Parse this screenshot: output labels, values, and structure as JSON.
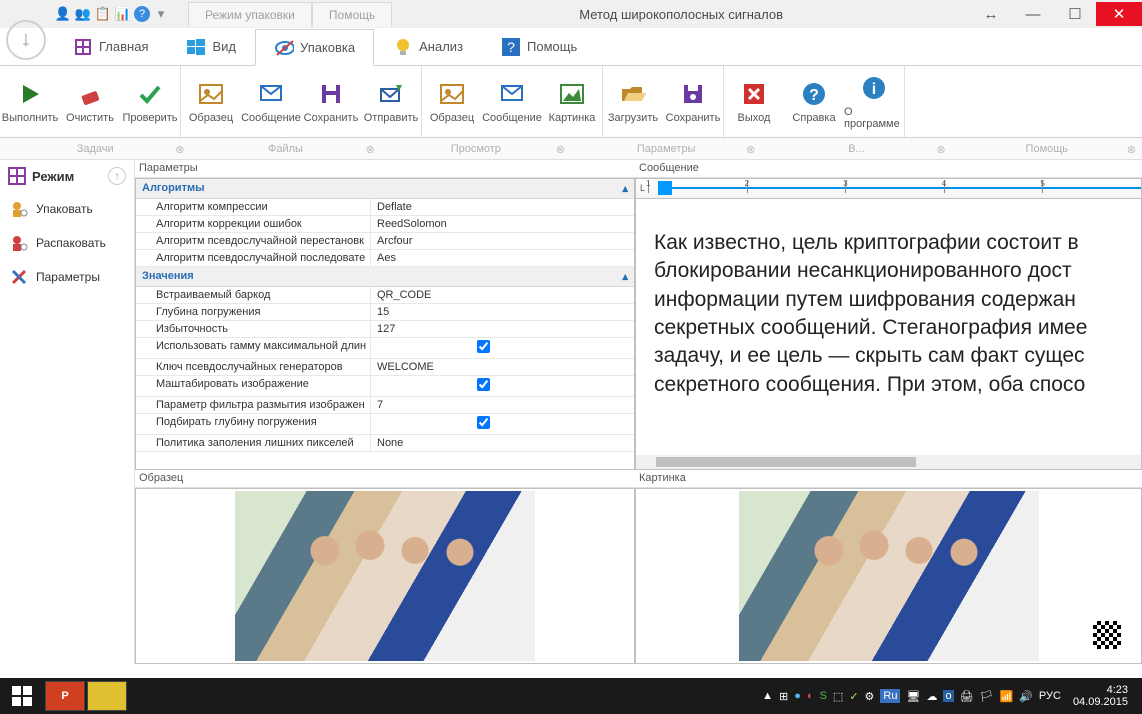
{
  "window": {
    "title": "Метод широкополосных сигналов",
    "top_tabs": [
      "Режим упаковки",
      "Помощь"
    ]
  },
  "main_tabs": [
    {
      "label": "Главная",
      "icon": "logo"
    },
    {
      "label": "Вид",
      "icon": "windows"
    },
    {
      "label": "Упаковка",
      "icon": "eye-off",
      "active": true
    },
    {
      "label": "Анализ",
      "icon": "bulb"
    },
    {
      "label": "Помощь",
      "icon": "help-box"
    }
  ],
  "ribbon_groups": [
    [
      {
        "label": "Выполнить",
        "icon": "play",
        "color": "#2a7a2a"
      },
      {
        "label": "Очистить",
        "icon": "eraser",
        "color": "#d04040"
      },
      {
        "label": "Проверить",
        "icon": "check",
        "color": "#2aa050"
      }
    ],
    [
      {
        "label": "Образец",
        "icon": "image",
        "color": "#c0882a"
      },
      {
        "label": "Сообщение",
        "icon": "message",
        "color": "#2a70c0"
      },
      {
        "label": "Сохранить",
        "icon": "save",
        "color": "#6a3aa0"
      },
      {
        "label": "Отправить",
        "icon": "send",
        "color": "#2a60a0"
      }
    ],
    [
      {
        "label": "Образец",
        "icon": "image",
        "color": "#c0882a"
      },
      {
        "label": "Сообщение",
        "icon": "message",
        "color": "#2a70c0"
      },
      {
        "label": "Картинка",
        "icon": "picture",
        "color": "#3a8a3a"
      }
    ],
    [
      {
        "label": "Загрузить",
        "icon": "folder-open",
        "color": "#c0882a"
      },
      {
        "label": "Сохранить",
        "icon": "disk",
        "color": "#6a3aa0"
      }
    ],
    [
      {
        "label": "Выход",
        "icon": "close-box",
        "color": "#d03030"
      },
      {
        "label": "Справка",
        "icon": "help-circle",
        "color": "#2a80c0"
      },
      {
        "label": "О программе",
        "icon": "info",
        "color": "#2a80c0"
      }
    ]
  ],
  "section_labels": [
    "Задачи",
    "Файлы",
    "Просмотр",
    "Параметры",
    "В...",
    "Помощь"
  ],
  "sidebar": {
    "header": "Режим",
    "items": [
      {
        "label": "Упаковать",
        "icon": "person-gear",
        "color": "#e0a030"
      },
      {
        "label": "Распаковать",
        "icon": "person-gear",
        "color": "#d04040"
      },
      {
        "label": "Параметры",
        "icon": "wrench-cross",
        "color": "#3a70c0"
      }
    ]
  },
  "panels": {
    "params_label": "Параметры",
    "msg_label": "Сообщение",
    "sample_label": "Образец",
    "picture_label": "Картинка"
  },
  "param_grid": {
    "cat1": "Алгоритмы",
    "rows1": [
      {
        "name": "Алгоритм компрессии",
        "value": "Deflate"
      },
      {
        "name": "Алгоритм коррекции ошибок",
        "value": "ReedSolomon"
      },
      {
        "name": "Алгоритм псевдослучайной перестановк",
        "value": "Arcfour"
      },
      {
        "name": "Алгоритм псевдослучайной последовате",
        "value": "Aes"
      }
    ],
    "cat2": "Значения",
    "rows2": [
      {
        "name": "Встраиваемый баркод",
        "value": "QR_CODE"
      },
      {
        "name": "Глубина погружения",
        "value": "15"
      },
      {
        "name": "Избыточность",
        "value": "127"
      },
      {
        "name": "Использовать гамму максимальной длин",
        "checkbox": true
      },
      {
        "name": "Ключ псевдослучайных генераторов",
        "value": "WELCOME"
      },
      {
        "name": "Маштабировать изображение",
        "checkbox": true
      },
      {
        "name": "Параметр фильтра размытия изображен",
        "value": "7"
      },
      {
        "name": "Подбирать глубину погружения",
        "checkbox": true
      },
      {
        "name": "Политика заполения лишних пикселей",
        "value": "None"
      }
    ]
  },
  "message_text": "Как известно, цель криптографии состоит в\nблокировании несанкционированного дост\nинформации путем шифрования содержан\nсекретных сообщений. Стеганография имее\nзадачу, и ее цель — скрыть сам факт сущес\nсекретного сообщения. При этом, оба спосо",
  "ruler_marks": [
    "1",
    "2",
    "3",
    "4",
    "5"
  ],
  "taskbar": {
    "lang": "РУС",
    "lang_short": "Ru",
    "time": "4:23",
    "date": "04.09.2015"
  }
}
